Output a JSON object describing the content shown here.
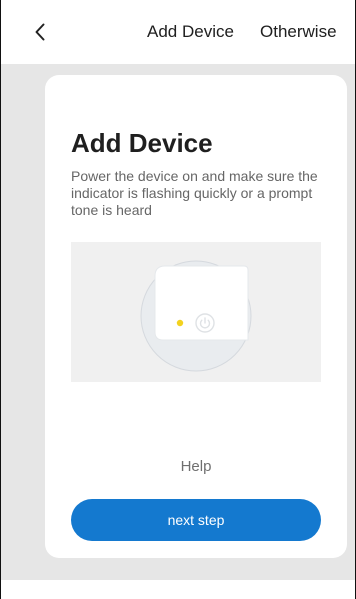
{
  "header": {
    "back_icon": "chevron-left-icon",
    "title": "Add Device",
    "action_label": "Otherwise"
  },
  "card": {
    "title": "Add Device",
    "description": "Power the device on and make sure the indicator is flashing quickly or a prompt tone is heard",
    "illustration": {
      "indicator_color": "#f3d21f",
      "power_icon": "power-icon"
    },
    "help_label": "Help",
    "next_button_label": "next step"
  },
  "colors": {
    "page_background": "#e6e6e6",
    "card_background": "#ffffff",
    "primary_button": "#1479cf",
    "indicator_yellow": "#f3d21f"
  }
}
